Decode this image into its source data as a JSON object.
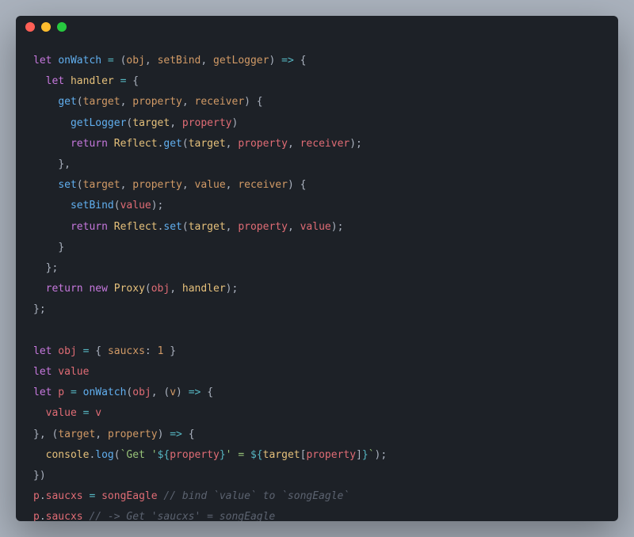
{
  "window": {
    "trafficLights": {
      "red": "#FF5F56",
      "yellow": "#FFBD2E",
      "green": "#27C93F"
    }
  },
  "code": {
    "l1": {
      "let": "let",
      "onWatch": "onWatch",
      "eq": " = ",
      "open": "(",
      "obj": "obj",
      "c1": ", ",
      "setBind": "setBind",
      "c2": ", ",
      "getLogger": "getLogger",
      "close": ")",
      "arrow": " => ",
      "brace": "{"
    },
    "l2": {
      "indent": "  ",
      "let": "let",
      "handler": " handler",
      "eq": " = ",
      "brace": "{"
    },
    "l3": {
      "indent": "    ",
      "get": "get",
      "open": "(",
      "target": "target",
      "c1": ", ",
      "property": "property",
      "c2": ", ",
      "receiver": "receiver",
      "close": ")",
      "brace": " {"
    },
    "l4": {
      "indent": "      ",
      "getLogger": "getLogger",
      "open": "(",
      "target": "target",
      "c1": ", ",
      "property": "property",
      "close": ")"
    },
    "l5": {
      "indent": "      ",
      "return": "return",
      "Reflect": " Reflect",
      "dot": ".",
      "get": "get",
      "open": "(",
      "target": "target",
      "c1": ", ",
      "property": "property",
      "c2": ", ",
      "receiver": "receiver",
      "close": ");"
    },
    "l6": {
      "indent": "    ",
      "closeb": "},"
    },
    "l7": {
      "indent": "    ",
      "set": "set",
      "open": "(",
      "target": "target",
      "c1": ", ",
      "property": "property",
      "c2": ", ",
      "value": "value",
      "c3": ", ",
      "receiver": "receiver",
      "close": ")",
      "brace": " {"
    },
    "l8": {
      "indent": "      ",
      "setBind": "setBind",
      "open": "(",
      "value": "value",
      "close": ");"
    },
    "l9": {
      "indent": "      ",
      "return": "return",
      "Reflect": " Reflect",
      "dot": ".",
      "set": "set",
      "open": "(",
      "target": "target",
      "c1": ", ",
      "property": "property",
      "c2": ", ",
      "value": "value",
      "close": ");"
    },
    "l10": {
      "indent": "    ",
      "closeb": "}"
    },
    "l11": {
      "indent": "  ",
      "closeb": "};"
    },
    "l12": {
      "indent": "  ",
      "return": "return",
      "new": " new",
      "Proxy": " Proxy",
      "open": "(",
      "obj": "obj",
      "c1": ", ",
      "handler": "handler",
      "close": ");"
    },
    "l13": {
      "closeb": "};"
    },
    "l14": {
      "blank": ""
    },
    "l15": {
      "let": "let",
      "obj": " obj",
      "eq": " = ",
      "open": "{ ",
      "saucxs": "saucxs",
      "colon": ": ",
      "one": "1",
      "close": " }"
    },
    "l16": {
      "let": "let",
      "value": " value"
    },
    "l17": {
      "let": "let",
      "p": " p",
      "eq": " = ",
      "onWatch": "onWatch",
      "open": "(",
      "obj": "obj",
      "c1": ", ",
      "open2": "(",
      "v": "v",
      "close2": ")",
      "arrow": " => ",
      "brace": "{"
    },
    "l18": {
      "indent": "  ",
      "value": "value",
      "eq": " = ",
      "v": "v"
    },
    "l19": {
      "close": "}, ",
      "open": "(",
      "target": "target",
      "c1": ", ",
      "property": "property",
      "close2": ")",
      "arrow": " => ",
      "brace": "{"
    },
    "l20": {
      "indent": "  ",
      "console": "console",
      "dot": ".",
      "log": "log",
      "open": "(",
      "tick": "`Get '",
      "d1": "${",
      "property": "property",
      "d1e": "}",
      "mid": "' = ",
      "d2": "${",
      "target": "target",
      "lb": "[",
      "prop2": "property",
      "rb": "]",
      "d2e": "}",
      "tickend": "`",
      "close": ");"
    },
    "l21": {
      "close": "})"
    },
    "l22": {
      "p": "p",
      "dot": ".",
      "saucxs": "saucxs",
      "eq": " = ",
      "songEagle": "songEagle",
      "cm": " // bind `value` to `songEagle`"
    },
    "l23": {
      "p": "p",
      "dot": ".",
      "saucxs": "saucxs",
      "cm": " // -> Get 'saucxs' = songEagle"
    }
  }
}
